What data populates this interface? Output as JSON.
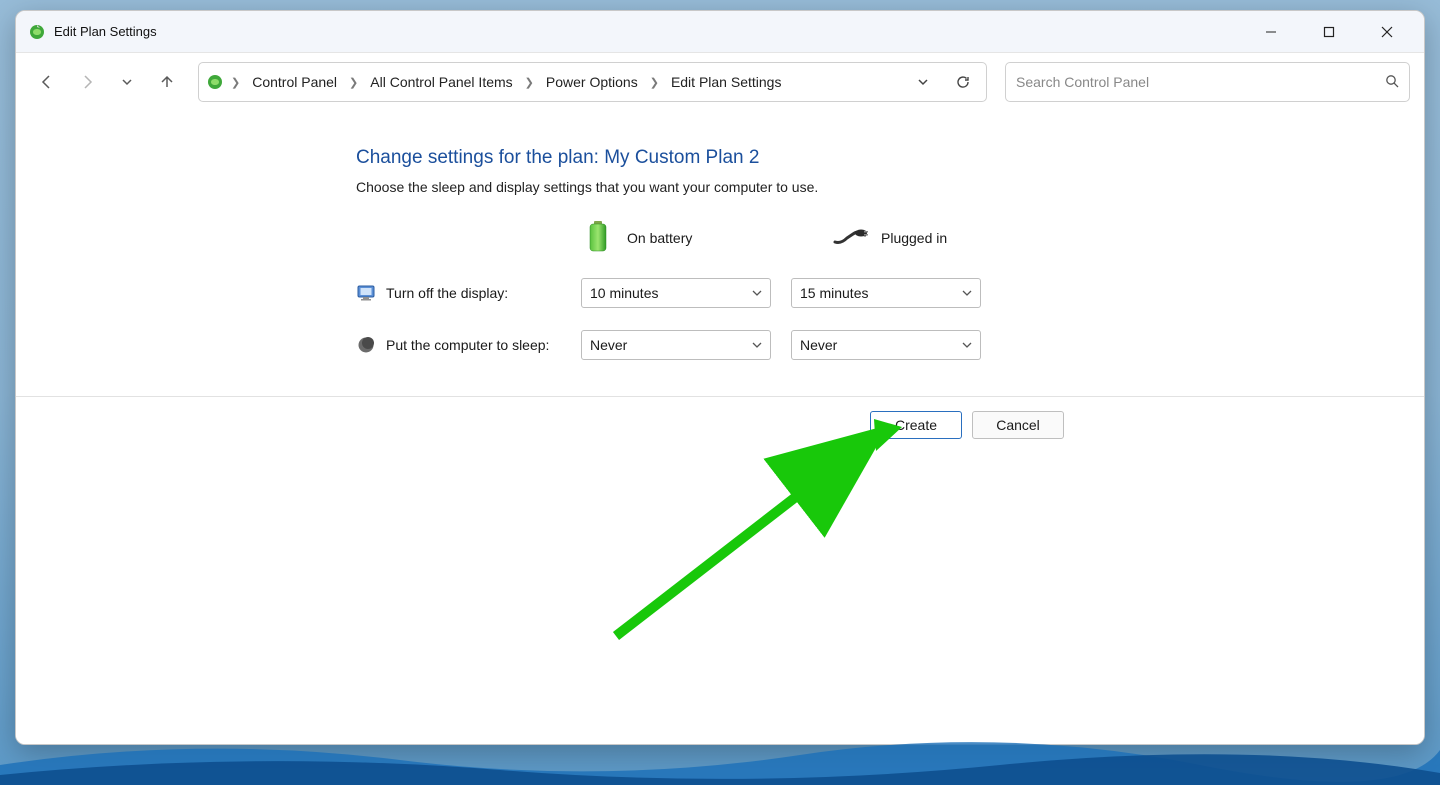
{
  "window": {
    "title": "Edit Plan Settings"
  },
  "breadcrumbs": {
    "items": [
      "Control Panel",
      "All Control Panel Items",
      "Power Options",
      "Edit Plan Settings"
    ]
  },
  "search": {
    "placeholder": "Search Control Panel"
  },
  "page": {
    "heading": "Change settings for the plan: My Custom Plan 2",
    "subtext": "Choose the sleep and display settings that you want your computer to use."
  },
  "columns": {
    "battery": "On battery",
    "plugged": "Plugged in"
  },
  "settings": {
    "display_off": {
      "label": "Turn off the display:",
      "battery": "10 minutes",
      "plugged": "15 minutes"
    },
    "sleep": {
      "label": "Put the computer to sleep:",
      "battery": "Never",
      "plugged": "Never"
    }
  },
  "buttons": {
    "create": "Create",
    "cancel": "Cancel"
  },
  "annotation": {
    "color": "#18c80a"
  }
}
